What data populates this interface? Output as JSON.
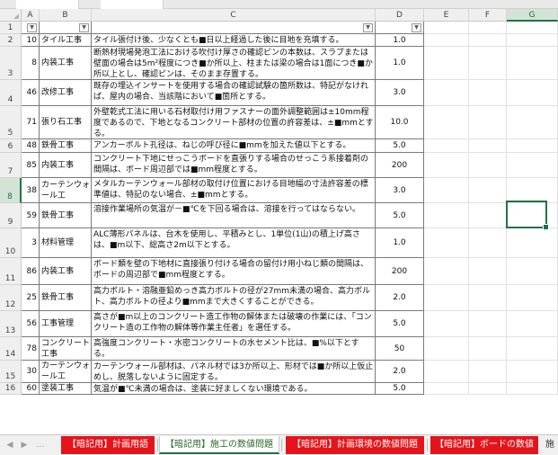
{
  "columns": {
    "A": "A",
    "B": "B",
    "C": "C",
    "D": "D",
    "E": "E",
    "F": "F",
    "G": "G"
  },
  "rows": [
    {
      "row": "1",
      "a": "",
      "b": "",
      "c": "",
      "d": ""
    },
    {
      "row": "2",
      "a": "10",
      "b": "タイル工事",
      "c": "タイル張付け後、少なくとも■日以上経過した後に目地を充填する。",
      "d": "1.0"
    },
    {
      "row": "3",
      "a": "8",
      "b": "内装工事",
      "c": "断熱材現場発泡工法における吹付け厚さの確認ピンの本数は、スラブまたは壁面の場合は5m²程度につき■か所以上、柱または梁の場合は1面につき■か所以上とし、確認ピンは、そのまま存置する。",
      "d": "1.0"
    },
    {
      "row": "4",
      "a": "46",
      "b": "改修工事",
      "c": "既存の埋込インサートを使用する場合の確認試験の箇所数は、特記がなければ、屋内の場合、当該階において■箇所とする。",
      "d": "3.0"
    },
    {
      "row": "5",
      "a": "71",
      "b": "張り石工事",
      "c": "外壁乾式工法に用いる石材取付け用ファスナーの面外調整範囲は±10mm程度であるので、下地となるコンクリート部材の位置の許容差は、±■mmとする。",
      "d": "10.0"
    },
    {
      "row": "6",
      "a": "48",
      "b": "鉄骨工事",
      "c": "アンカーボルト孔径は、ねじの呼び径に■mmを加えた値以下とする。",
      "d": "5.0"
    },
    {
      "row": "7",
      "a": "85",
      "b": "内装工事",
      "c": "コンクリート下地にせっこうボードを直張りする場合のせっこう系接着剤の間隔は、ボード周辺部では■mm程度とする。",
      "d": "200"
    },
    {
      "row": "8",
      "a": "38",
      "b": "カーテンウォール工",
      "c": "メタルカーテンウォール部材の取付け位置における目地幅の寸法許容差の標準値は、特記のない場合、±■mmとする。",
      "d": "3.0"
    },
    {
      "row": "9",
      "a": "59",
      "b": "鉄骨工事",
      "c": "溶接作業場所の気温が－■℃を下回る場合は、溶接を行ってはならない。",
      "d": "5.0"
    },
    {
      "row": "10",
      "a": "3",
      "b": "材料管理",
      "c": "ALC薄形パネルは、台木を使用し、平積みとし、1単位(1山)の積上げ高さは、■m以下、総高さ2m以下とする。",
      "d": "1.0"
    },
    {
      "row": "11",
      "a": "86",
      "b": "内装工事",
      "c": "ボード類を壁の下地材に直接張り付ける場合の留付け用小ねじ類の間隔は、ボードの周辺部で■mm程度とする。",
      "d": "200"
    },
    {
      "row": "12",
      "a": "25",
      "b": "鉄骨工事",
      "c": "高力ボルト・溶融亜鉛めっき高力ボルトの径が27mm未満の場合、高力ボルト、高力ボルトの径より■mmまで大きくすることができる。",
      "d": "2.0"
    },
    {
      "row": "13",
      "a": "56",
      "b": "工事管理",
      "c": "高さが■m以上のコンクリート造工作物の解体または破壊の作業には、「コンクリート造の工作物の解体等作業主任者」を選任する。",
      "d": "5.0"
    },
    {
      "row": "14",
      "a": "78",
      "b": "コンクリート工事",
      "c": "高強度コンクリート・水密コンクリートの水セメント比は、■%以下とする。",
      "d": "50"
    },
    {
      "row": "15",
      "a": "30",
      "b": "カーテンウォール工",
      "c": "カーテンウォール部材は、パネル材では3か所以上、形材では■か所以上仮止めし、脱落しないように固定する。",
      "d": "2.0"
    },
    {
      "row": "16",
      "a": "60",
      "b": "塗装工事",
      "c": "気温が■℃未満の場合は、塗装に好ましくない環境である。",
      "d": "5.0"
    }
  ],
  "name_box_selection": "G8",
  "sheet_tabs": [
    {
      "label": "【暗記用】計画用語",
      "style": "red"
    },
    {
      "label": "【暗記用】施工の数値問題",
      "style": "active"
    },
    {
      "label": "【暗記用】計画環境の数値問題",
      "style": "red"
    },
    {
      "label": "【暗記用】ボードの数値",
      "style": "red"
    },
    {
      "label": "施",
      "style": "plain"
    }
  ],
  "colors": {
    "accent": "#217346",
    "tab_red": "#e5141b"
  }
}
